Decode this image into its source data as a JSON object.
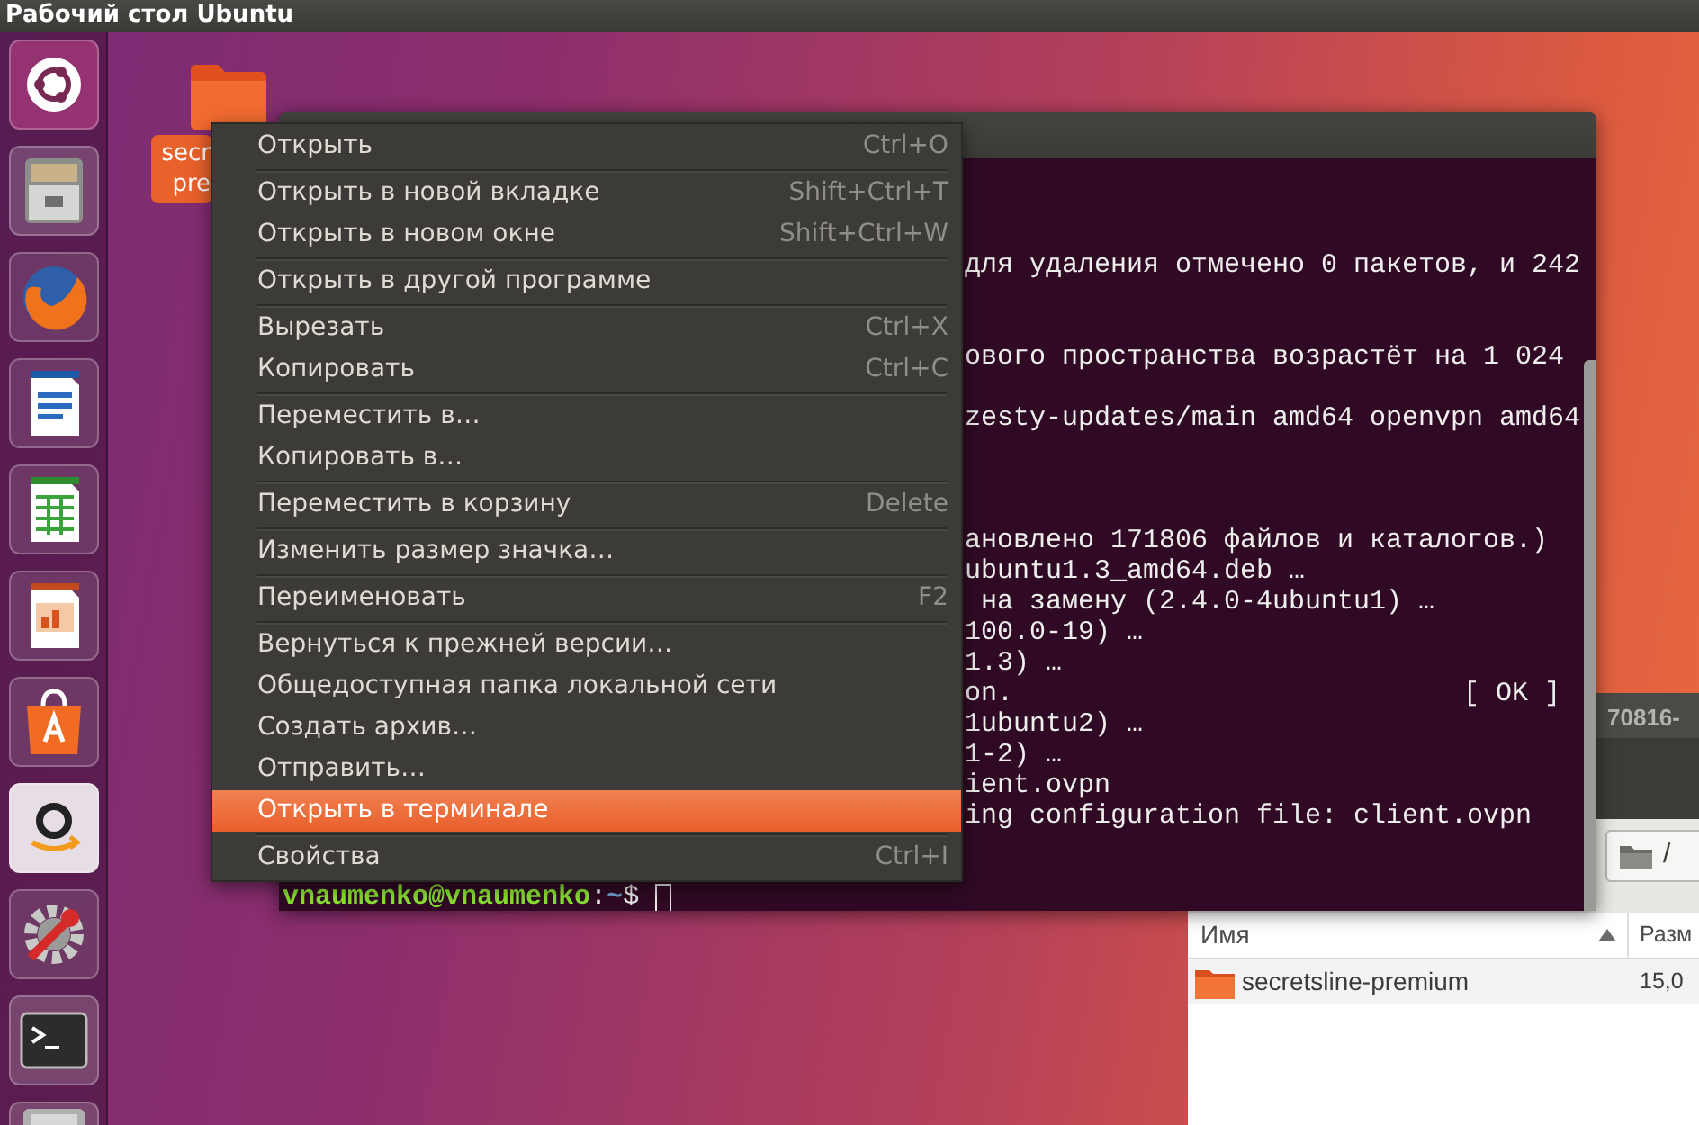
{
  "top_bar": {
    "title": "Рабочий стол Ubuntu"
  },
  "launcher": [
    {
      "kind": "dash"
    },
    {
      "kind": "files"
    },
    {
      "kind": "browser"
    },
    {
      "kind": "writer"
    },
    {
      "kind": "calc"
    },
    {
      "kind": "impress"
    },
    {
      "kind": "store"
    },
    {
      "kind": "shop"
    },
    {
      "kind": "settings"
    },
    {
      "kind": "terminal"
    },
    {
      "kind": "drive"
    }
  ],
  "desktop_icon": {
    "label_lines": [
      "secr",
      "pre"
    ],
    "selected": true
  },
  "terminal": {
    "lines": [
      {
        "text": "для удаления отмечено 0 пакетов, и 242"
      },
      {
        "text": "ового пространства возрастёт на 1 024"
      },
      {
        "text": "zesty-updates/main amd64 openvpn amd64"
      },
      {
        "text": "ановлено 171806 файлов и каталогов.)"
      },
      {
        "text": "ubuntu1.3_amd64.deb …"
      },
      {
        "text": " на замену (2.4.0-4ubuntu1) …"
      },
      {
        "text": "100.0-19) …"
      },
      {
        "text": "1.3) …"
      },
      {
        "text": "on.",
        "status": "[ OK ]"
      },
      {
        "text": "1ubuntu2) …"
      },
      {
        "text": "1-2) …"
      },
      {
        "text": "ient.ovpn"
      },
      {
        "text": "ing configuration file: client.ovpn"
      }
    ],
    "prompt": {
      "user_host": "vnaumenko@vnaumenko",
      "separator": ":",
      "path": "~",
      "symbol": "$"
    }
  },
  "file_manager": {
    "title": "70816-",
    "location": "/",
    "columns": [
      "Имя",
      "Разм"
    ],
    "rows": [
      {
        "name": "secretsline-premium",
        "size": "15,0"
      }
    ]
  },
  "context_menu": {
    "items": [
      {
        "kind": "item",
        "label": "Открыть",
        "shortcut": "Ctrl+O",
        "selected": false
      },
      {
        "kind": "separator"
      },
      {
        "kind": "item",
        "label": "Открыть в новой вкладке",
        "shortcut": "Shift+Ctrl+T",
        "selected": false
      },
      {
        "kind": "item",
        "label": "Открыть в новом окне",
        "shortcut": "Shift+Ctrl+W",
        "selected": false
      },
      {
        "kind": "separator"
      },
      {
        "kind": "item",
        "label": "Открыть в другой программе",
        "selected": false
      },
      {
        "kind": "separator"
      },
      {
        "kind": "item",
        "label": "Вырезать",
        "shortcut": "Ctrl+X",
        "selected": false
      },
      {
        "kind": "item",
        "label": "Копировать",
        "shortcut": "Ctrl+C",
        "selected": false
      },
      {
        "kind": "separator"
      },
      {
        "kind": "item",
        "label": "Переместить в…",
        "selected": false
      },
      {
        "kind": "item",
        "label": "Копировать в…",
        "selected": false
      },
      {
        "kind": "separator"
      },
      {
        "kind": "item",
        "label": "Переместить в корзину",
        "shortcut": "Delete",
        "selected": false
      },
      {
        "kind": "separator"
      },
      {
        "kind": "item",
        "label": "Изменить размер значка…",
        "selected": false
      },
      {
        "kind": "separator"
      },
      {
        "kind": "item",
        "label": "Переименовать",
        "shortcut": "F2",
        "selected": false
      },
      {
        "kind": "separator"
      },
      {
        "kind": "item",
        "label": "Вернуться к прежней версии…",
        "selected": false
      },
      {
        "kind": "item",
        "label": "Общедоступная папка локальной сети",
        "selected": false
      },
      {
        "kind": "item",
        "label": "Создать архив…",
        "selected": false
      },
      {
        "kind": "item",
        "label": "Отправить…",
        "selected": false
      },
      {
        "kind": "item",
        "label": "Открыть в терминале",
        "selected": true
      },
      {
        "kind": "separator"
      },
      {
        "kind": "item",
        "label": "Свойства",
        "shortcut": "Ctrl+I",
        "selected": false
      }
    ]
  }
}
